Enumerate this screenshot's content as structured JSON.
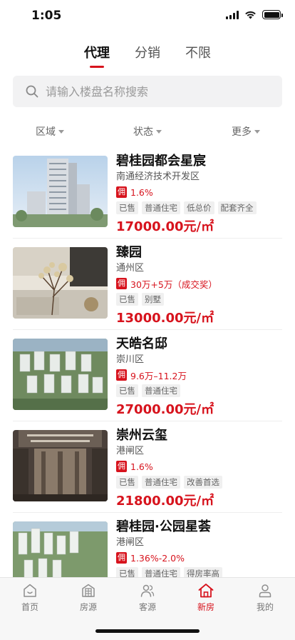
{
  "status_bar": {
    "time": "1:05"
  },
  "tabs": [
    {
      "label": "代理",
      "active": true
    },
    {
      "label": "分销",
      "active": false
    },
    {
      "label": "不限",
      "active": false
    }
  ],
  "search": {
    "placeholder": "请输入楼盘名称搜索",
    "value": ""
  },
  "filters": [
    {
      "label": "区域"
    },
    {
      "label": "状态"
    },
    {
      "label": "更多"
    }
  ],
  "listings": [
    {
      "name": "碧桂园都会星宸",
      "district": "南通经济技术开发区",
      "commission_badge": "佣",
      "commission": "1.6%",
      "tags": [
        "已售",
        "普通住宅",
        "低总价",
        "配套齐全"
      ],
      "price": "17000.00元/㎡"
    },
    {
      "name": "臻园",
      "district": "通州区",
      "commission_badge": "佣",
      "commission": "30万+5万（成交奖）",
      "tags": [
        "已售",
        "别墅"
      ],
      "price": "13000.00元/㎡"
    },
    {
      "name": "天皓名邸",
      "district": "崇川区",
      "commission_badge": "佣",
      "commission": "9.6万–11.2万",
      "tags": [
        "已售",
        "普通住宅"
      ],
      "price": "27000.00元/㎡"
    },
    {
      "name": "崇州云玺",
      "district": "港闸区",
      "commission_badge": "佣",
      "commission": "1.6%",
      "tags": [
        "已售",
        "普通住宅",
        "改善首选"
      ],
      "price": "21800.00元/㎡"
    },
    {
      "name": "碧桂园·公园星荟",
      "district": "港闸区",
      "commission_badge": "佣",
      "commission": "1.36%-2.0%",
      "tags": [
        "已售",
        "普通住宅",
        "得房率高"
      ],
      "price": ""
    }
  ],
  "tabbar": [
    {
      "label": "首页",
      "icon": "home-outline-icon",
      "active": false
    },
    {
      "label": "房源",
      "icon": "building-icon",
      "active": false
    },
    {
      "label": "客源",
      "icon": "people-icon",
      "active": false
    },
    {
      "label": "新房",
      "icon": "new-house-icon",
      "active": true
    },
    {
      "label": "我的",
      "icon": "person-icon",
      "active": false
    }
  ],
  "colors": {
    "accent": "#d7131d",
    "text": "#111111",
    "muted": "#999999"
  }
}
